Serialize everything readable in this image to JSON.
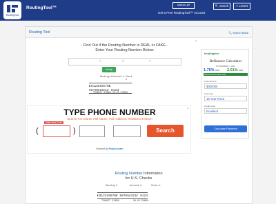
{
  "header": {
    "logo_caption": "RoutingTool",
    "brand": "RoutingTool™",
    "signup_label": "SIGN UP",
    "tagline": "Get a Free RoutingTool™ Account",
    "search_label": "Search",
    "login_label": "LOGIN",
    "colors": {
      "bar": "#1f3c88"
    }
  },
  "panel": {
    "title": "Routing Tool",
    "search_bank": "Search Bank"
  },
  "intro": {
    "line1": "- Find Out if the Routing Number is REAL or FAKE...",
    "line2": "Enter Your Routing Number Below:"
  },
  "verify_label": "Verify",
  "check_small": {
    "routing_label": "Routing #",
    "account_label": "Account #",
    "check_label": "Check #",
    "digits": "⑆012345678⑆ 987654321⑈ 0123",
    "transit_label": "TRANSIT SYMBOL",
    "onus_label": "ON-US SYMBOL"
  },
  "ad": {
    "title": "TYPE PHONE NUMBER",
    "subtitle": "Search For Owner Full Name, Full Address, Relatives & More!",
    "area_label": "Enter Area Code",
    "paren_open": "(",
    "paren_close": ")",
    "dash": "–",
    "search_button": "Search",
    "powered_prefix": "Powered By",
    "powered_brand": "PeopleLooker"
  },
  "calculator": {
    "logo": "lendingtree",
    "title": "Refinance Calculator",
    "date": "NOVEMBER 1, 2021",
    "rate1": "1.75%",
    "rate1_unit": "APR",
    "rate2": "2.01%",
    "rate2_unit": "APR",
    "rate_bar": "Subscribe Nov (loan see)",
    "loan_label": "Loan amount",
    "loan_value": "$300000",
    "loan_type_label": "Loan type",
    "loan_type_value": "15-Year Fixed",
    "credit_label": "Credit score",
    "credit_value": "Excellent",
    "button": "Calculate Payment"
  },
  "info": {
    "highlight": "Routing Number",
    "rest": " Information",
    "line2": "for U.S. Checks"
  }
}
